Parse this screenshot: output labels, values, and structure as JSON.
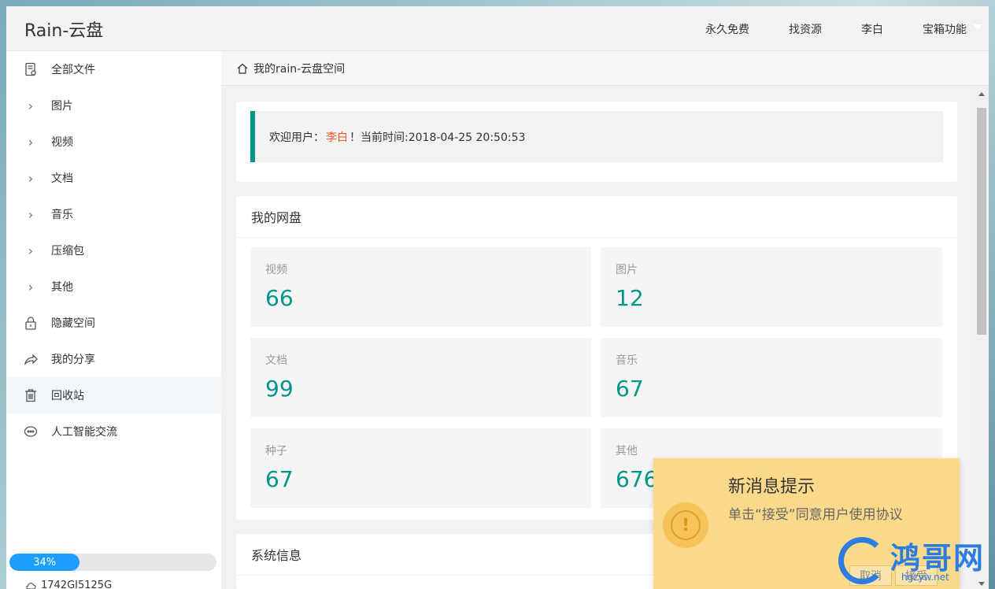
{
  "header": {
    "logo": "Rain-云盘",
    "nav": [
      "永久免费",
      "找资源",
      "李白",
      "宝箱功能"
    ]
  },
  "sidebar": {
    "items": [
      {
        "label": "全部文件",
        "icon": "file-icon"
      },
      {
        "label": "图片",
        "icon": "chevron-right-icon"
      },
      {
        "label": "视频",
        "icon": "chevron-right-icon"
      },
      {
        "label": "文档",
        "icon": "chevron-right-icon"
      },
      {
        "label": "音乐",
        "icon": "chevron-right-icon"
      },
      {
        "label": "压缩包",
        "icon": "chevron-right-icon"
      },
      {
        "label": "其他",
        "icon": "chevron-right-icon"
      },
      {
        "label": "隐藏空间",
        "icon": "lock-icon"
      },
      {
        "label": "我的分享",
        "icon": "share-icon"
      },
      {
        "label": "回收站",
        "icon": "trash-icon"
      },
      {
        "label": "人工智能交流",
        "icon": "chat-icon"
      }
    ],
    "usage_percent": 34,
    "usage_label": "34%",
    "storage_text": "1742GI5125G"
  },
  "breadcrumb": {
    "text": "我的rain-云盘空间"
  },
  "welcome": {
    "prefix": "欢迎用户：",
    "user": "李白",
    "suffix": "！当前时间:2018-04-25 20:50:53"
  },
  "disk": {
    "title": "我的网盘",
    "stats": [
      {
        "label": "视频",
        "value": "66"
      },
      {
        "label": "图片",
        "value": "12"
      },
      {
        "label": "文档",
        "value": "99"
      },
      {
        "label": "音乐",
        "value": "67"
      },
      {
        "label": "种子",
        "value": "67"
      },
      {
        "label": "其他",
        "value": "676"
      }
    ]
  },
  "system": {
    "title": "系统信息"
  },
  "toast": {
    "title": "新消息提示",
    "text": "单击“接受”同意用户使用协议",
    "cancel": "取消",
    "accept": "接受"
  },
  "watermark": {
    "text": "鸿哥网",
    "url": "hgzyw.net"
  },
  "colors": {
    "accent": "#009688",
    "progress": "#1e9fff",
    "highlight": "#ff5722",
    "toast_bg": "#fbd98a"
  }
}
